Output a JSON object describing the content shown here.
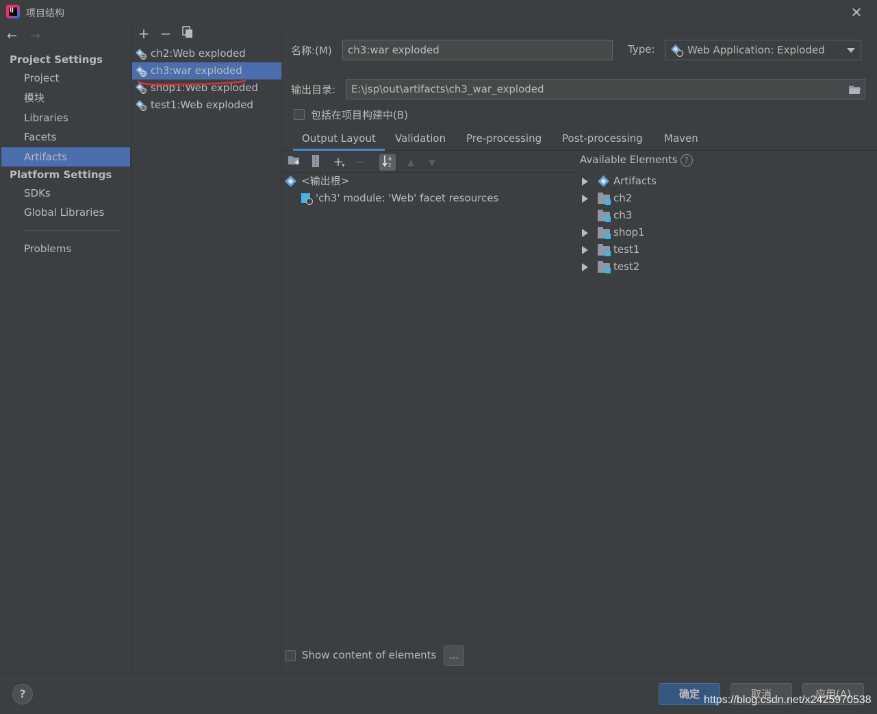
{
  "window": {
    "title": "项目结构"
  },
  "nav": {
    "project_settings_header": "Project Settings",
    "project_items": [
      "Project",
      "模块",
      "Libraries",
      "Facets",
      "Artifacts"
    ],
    "platform_settings_header": "Platform Settings",
    "platform_items": [
      "SDKs",
      "Global Libraries"
    ],
    "problems": "Problems",
    "selected": "Artifacts"
  },
  "artifacts": {
    "items": [
      "ch2:Web exploded",
      "ch3:war exploded",
      "shop1:Web exploded",
      "test1:Web exploded"
    ],
    "selected": "ch3:war exploded"
  },
  "detail": {
    "name_label": "名称:(M)",
    "name_value": "ch3:war exploded",
    "type_label": "Type:",
    "type_value": "Web Application: Exploded",
    "output_label": "输出目录:",
    "output_value": "E:\\jsp\\out\\artifacts\\ch3_war_exploded",
    "include_in_build_label": "包括在项目构建中(B)",
    "include_in_build_checked": false,
    "tabs": [
      "Output Layout",
      "Validation",
      "Pre-processing",
      "Post-processing",
      "Maven"
    ],
    "active_tab": "Output Layout",
    "layout_tree": {
      "root": "<输出根>",
      "children": [
        "'ch3' module: 'Web' facet resources"
      ]
    },
    "available_elements_title": "Available Elements",
    "available_elements": [
      "Artifacts",
      "ch2",
      "ch3",
      "shop1",
      "test1",
      "test2"
    ],
    "show_content_label": "Show content of elements",
    "show_content_checked": false,
    "ellipsis_label": "..."
  },
  "bottom": {
    "help": "?",
    "ok": "确定",
    "cancel": "取消",
    "apply": "应用(A)",
    "watermark": "https://blog.csdn.net/x2425970538"
  },
  "colors": {
    "background": "#3c3f41",
    "selection": "#4b6eaf",
    "default_button": "#365880",
    "annotation_underline": "#e03030"
  }
}
